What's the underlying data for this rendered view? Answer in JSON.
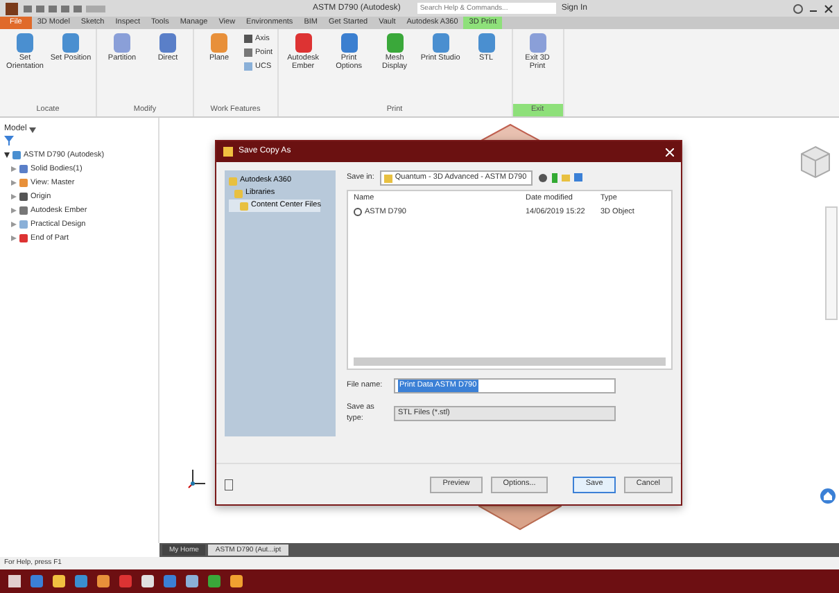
{
  "window": {
    "title": "ASTM D790 (Autodesk)",
    "search_placeholder": "Search Help & Commands...",
    "sign_in": "Sign In"
  },
  "ribbon_tabs": [
    {
      "label": "File",
      "selected": false,
      "kind": "file"
    },
    {
      "label": "3D Model",
      "selected": false,
      "kind": "tab"
    },
    {
      "label": "Sketch",
      "selected": false,
      "kind": "tab"
    },
    {
      "label": "Inspect",
      "selected": false,
      "kind": "tab"
    },
    {
      "label": "Tools",
      "selected": false,
      "kind": "tab"
    },
    {
      "label": "Manage",
      "selected": false,
      "kind": "tab"
    },
    {
      "label": "View",
      "selected": false,
      "kind": "tab"
    },
    {
      "label": "Environments",
      "selected": false,
      "kind": "tab"
    },
    {
      "label": "BIM",
      "selected": false,
      "kind": "tab"
    },
    {
      "label": "Get Started",
      "selected": false,
      "kind": "tab"
    },
    {
      "label": "Vault",
      "selected": false,
      "kind": "tab"
    },
    {
      "label": "Autodesk A360",
      "selected": false,
      "kind": "tab"
    },
    {
      "label": "3D Print",
      "selected": true,
      "kind": "tab"
    }
  ],
  "ribbon_groups": [
    {
      "label": "Locate",
      "accent": false,
      "buttons": [
        {
          "label": "Set Orientation",
          "kind": "large"
        },
        {
          "label": "Set Position",
          "kind": "large"
        }
      ]
    },
    {
      "label": "Modify",
      "accent": false,
      "buttons": [
        {
          "label": "Partition",
          "kind": "large"
        },
        {
          "label": "Direct",
          "kind": "large"
        }
      ]
    },
    {
      "label": "Work Features",
      "accent": false,
      "buttons": [
        {
          "label": "Plane",
          "kind": "large"
        },
        {
          "label": "Axis",
          "kind": "small"
        },
        {
          "label": "Point",
          "kind": "small"
        },
        {
          "label": "UCS",
          "kind": "small"
        }
      ]
    },
    {
      "label": "Print",
      "accent": false,
      "buttons": [
        {
          "label": "Autodesk Ember",
          "kind": "large"
        },
        {
          "label": "Print Options",
          "kind": "large"
        },
        {
          "label": "Mesh Display",
          "kind": "large"
        },
        {
          "label": "Print Studio",
          "kind": "large"
        },
        {
          "label": "STL",
          "kind": "large"
        }
      ]
    },
    {
      "label": "Exit",
      "accent": true,
      "buttons": [
        {
          "label": "Exit 3D Print",
          "kind": "large"
        }
      ]
    }
  ],
  "browser": {
    "title": "Model",
    "tree": [
      {
        "label": "ASTM D790 (Autodesk)",
        "expanded": true,
        "children": [
          {
            "label": "Solid Bodies(1)",
            "expanded": false
          },
          {
            "label": "View: Master",
            "expanded": false
          },
          {
            "label": "Origin",
            "expanded": false
          },
          {
            "label": "Autodesk Ember",
            "expanded": false
          },
          {
            "label": "Practical Design",
            "expanded": false
          },
          {
            "label": "End of Part",
            "expanded": false
          }
        ]
      }
    ]
  },
  "dialog": {
    "title": "Save Copy As",
    "places": [
      {
        "label": "Autodesk A360",
        "selected": false
      },
      {
        "label": "Libraries",
        "selected": false
      },
      {
        "label": "Content Center Files",
        "selected": true
      }
    ],
    "save_in_label": "Save in:",
    "save_in": "Quantum - 3D Advanced - ASTM D790",
    "columns": [
      "Name",
      "Date modified",
      "Type"
    ],
    "files": [
      {
        "name": "ASTM D790",
        "date": "14/06/2019 15:22",
        "type": "3D Object"
      }
    ],
    "file_name_label": "File name:",
    "file_name": "Print Data ASTM D790",
    "save_as_type_label": "Save as type:",
    "save_as_type": "STL Files (*.stl)",
    "buttons": [
      {
        "label": "Preview",
        "default": false
      },
      {
        "label": "Options...",
        "default": false
      },
      {
        "label": "Save",
        "default": true
      },
      {
        "label": "Cancel",
        "default": false
      }
    ]
  },
  "doc_tabs": [
    {
      "label": "My Home",
      "selected": false
    },
    {
      "label": "ASTM D790 (Aut...ipt",
      "selected": true
    }
  ],
  "status_bar": "For Help, press F1"
}
